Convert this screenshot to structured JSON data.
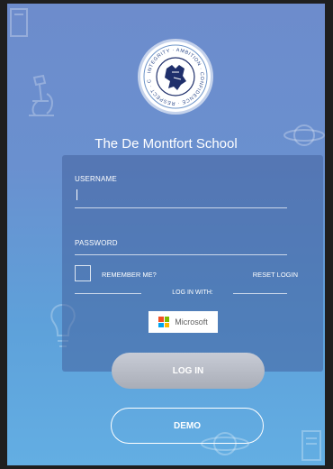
{
  "school": {
    "name": "The De Montfort School",
    "crest_words": [
      "INTEGRITY",
      "AMBITION",
      "CONFIDENCE",
      "RESPECT",
      "CREATIVITY"
    ]
  },
  "form": {
    "username_label": "USERNAME",
    "username_value": "",
    "password_label": "PASSWORD",
    "password_value": "",
    "remember_label": "REMEMBER ME?",
    "remember_checked": false,
    "reset_label": "RESET LOGIN",
    "login_with_label": "LOG IN WITH:",
    "microsoft_label": "Microsoft"
  },
  "buttons": {
    "login_label": "LOG IN",
    "demo_label": "DEMO"
  },
  "colors": {
    "microsoft_red": "#f25022",
    "microsoft_green": "#7fba00",
    "microsoft_blue": "#00a4ef",
    "microsoft_yellow": "#ffb900",
    "crest_navy": "#1f2f6b"
  },
  "icons": [
    "microscope-icon",
    "planet-icon",
    "lightbulb-icon",
    "microsoft-logo-icon",
    "school-crest-icon"
  ]
}
